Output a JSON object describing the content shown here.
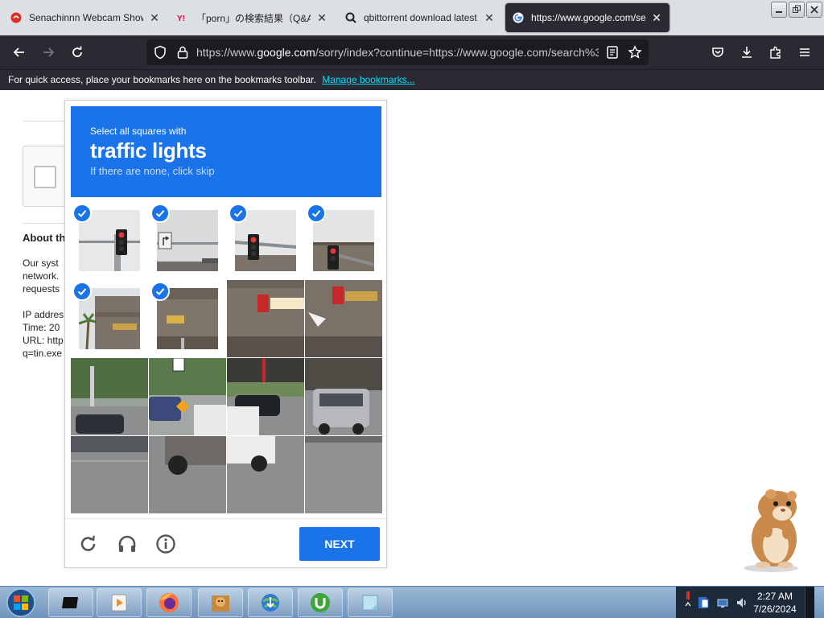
{
  "browser": {
    "tabs": [
      {
        "label": "Senachinnn Webcam Show |",
        "icon": "red-site-icon"
      },
      {
        "label": "「porn」の検索結果（Q&A",
        "icon": "yahoo-icon"
      },
      {
        "label": "qbittorrent download latest",
        "icon": "search-engine-icon"
      },
      {
        "label": "https://www.google.com/se",
        "icon": "google-icon",
        "active": true
      }
    ],
    "url_pre": "https://www.",
    "url_domain": "google.com",
    "url_post": "/sorry/index?continue=https://www.google.com/search%3",
    "bookmarks_message": "For quick access, place your bookmarks here on the bookmarks toolbar.",
    "bookmarks_link": "Manage bookmarks..."
  },
  "page": {
    "about_heading": "About th",
    "line1": "Our syst",
    "line2": "network.",
    "line3": "requests",
    "ip_label": "IP addres",
    "time_label": "Time: 20",
    "url_label": "URL: http",
    "q_label": "q=tin.exe"
  },
  "captcha": {
    "instruction": "Select all squares with",
    "target": "traffic lights",
    "hint": "If there are none, click skip",
    "next_label": "NEXT",
    "selected_tiles": [
      0,
      1,
      2,
      3,
      4,
      5
    ],
    "accent": "#1a73e8"
  },
  "taskbar": {
    "time": "2:27 AM",
    "date": "7/26/2024",
    "apps": [
      "terminal-app",
      "media-player-app",
      "firefox-app",
      "hamster-box-app",
      "internet-download-app",
      "utorrent-app",
      "notes-app"
    ]
  }
}
